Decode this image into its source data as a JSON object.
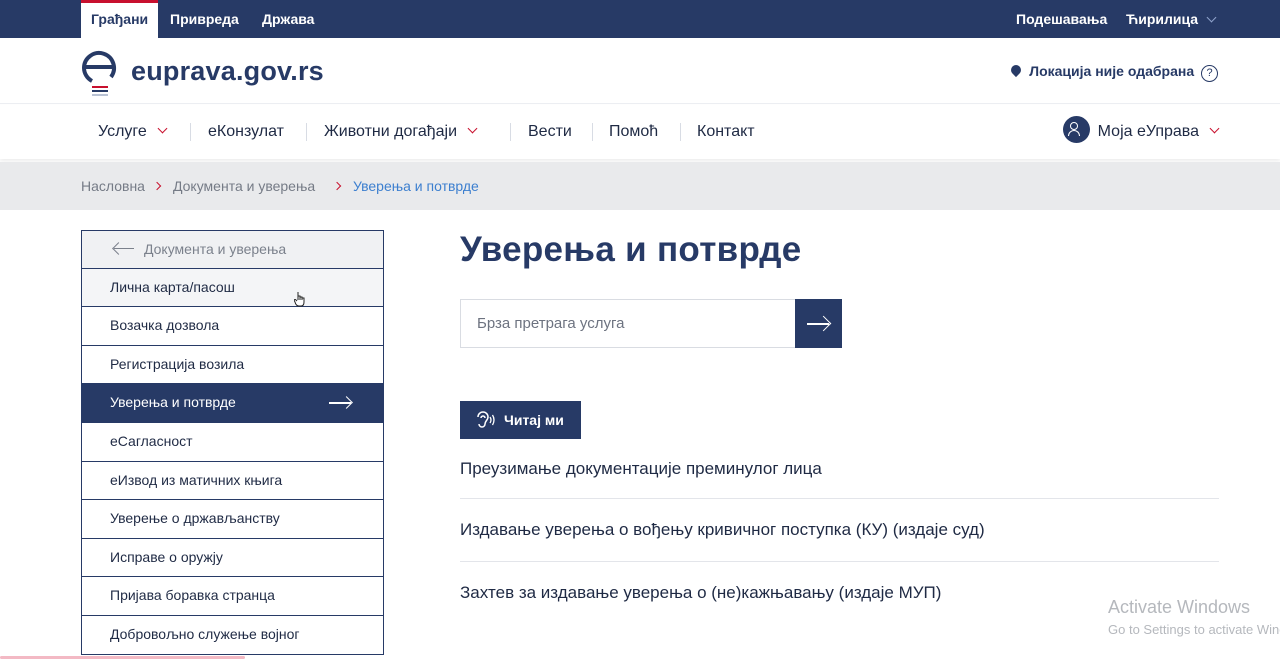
{
  "topbar": {
    "tabs": [
      {
        "label": "Грађани",
        "active": true
      },
      {
        "label": "Привреда",
        "active": false
      },
      {
        "label": "Држава",
        "active": false
      }
    ],
    "settings_label": "Подешавања",
    "script_label": "Ћирилица"
  },
  "header": {
    "logo_text": "euprava.gov.rs",
    "location_label": "Локација није одабрана",
    "help_symbol": "?"
  },
  "nav": {
    "items": [
      {
        "label": "Услуге",
        "dropdown": true
      },
      {
        "label": "еКонзулат",
        "dropdown": false
      },
      {
        "label": "Животни догађаји",
        "dropdown": true
      },
      {
        "label": "Вести",
        "dropdown": false
      },
      {
        "label": "Помоћ",
        "dropdown": false
      },
      {
        "label": "Контакт",
        "dropdown": false
      }
    ],
    "account_label": "Моја еУправа"
  },
  "breadcrumb": {
    "items": [
      "Насловна",
      "Документа и уверења",
      "Уверења и потврде"
    ]
  },
  "sidebar": {
    "back_label": "Документа и уверења",
    "items": [
      {
        "label": "Лична карта/пасош",
        "state": "hover"
      },
      {
        "label": "Возачка дозвола",
        "state": ""
      },
      {
        "label": "Регистрација возила",
        "state": ""
      },
      {
        "label": "Уверења и потврде",
        "state": "active"
      },
      {
        "label": "еСагласност",
        "state": ""
      },
      {
        "label": "еИзвод из матичних књига",
        "state": ""
      },
      {
        "label": "Уверење о држављанству",
        "state": ""
      },
      {
        "label": "Исправе о оружју",
        "state": ""
      },
      {
        "label": "Пријава боравка странца",
        "state": ""
      },
      {
        "label": "Добровољно служење војног",
        "state": ""
      }
    ]
  },
  "main": {
    "title": "Уверења и потврде",
    "search_placeholder": "Брза претрага услуга",
    "read_button": "Читај ми",
    "services": [
      "Преузимање документације преминулог лица",
      "Издавање уверења о вођењу кривичног поступка (КУ) (издаје суд)",
      "Захтев за издавање уверења о (не)кажњавању (издаје МУП)"
    ]
  },
  "watermark": {
    "line1": "Activate Windows",
    "line2": "Go to Settings to activate Windows."
  },
  "colors": {
    "primary": "#273a66",
    "accent_red": "#c8102e",
    "link_blue": "#3c7fcf",
    "breadcrumb_bg": "#e9eaec"
  }
}
